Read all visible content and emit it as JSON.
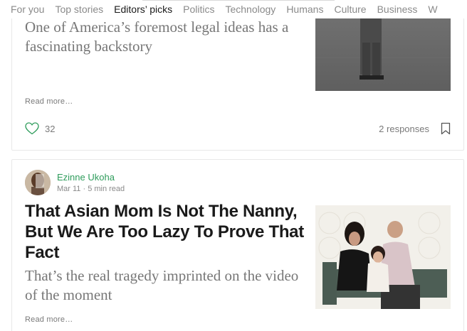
{
  "nav": {
    "tabs": [
      "For you",
      "Top stories",
      "Editors’ picks",
      "Politics",
      "Technology",
      "Humans",
      "Culture",
      "Business",
      "W"
    ],
    "active_index": 2
  },
  "story1": {
    "subtitle": "One of America’s foremost legal ideas has a fascinating backstory",
    "read_more": "Read more…",
    "claps": "32",
    "responses": "2 responses"
  },
  "story2": {
    "author": "Ezinne Ukoha",
    "meta": "Mar 11 · 5 min read",
    "title": "That Asian Mom Is Not The Nanny, But We Are Too Lazy To Prove That Fact",
    "subtitle": "That’s the real tragedy imprinted on the video of the moment",
    "read_more": "Read more…"
  },
  "icons": {
    "clap": "heart-icon",
    "bookmark": "bookmark-icon"
  },
  "colors": {
    "author_green": "#2e9c5b",
    "active_tab": "#1a1a1a",
    "muted_text": "#7a7a7a"
  }
}
